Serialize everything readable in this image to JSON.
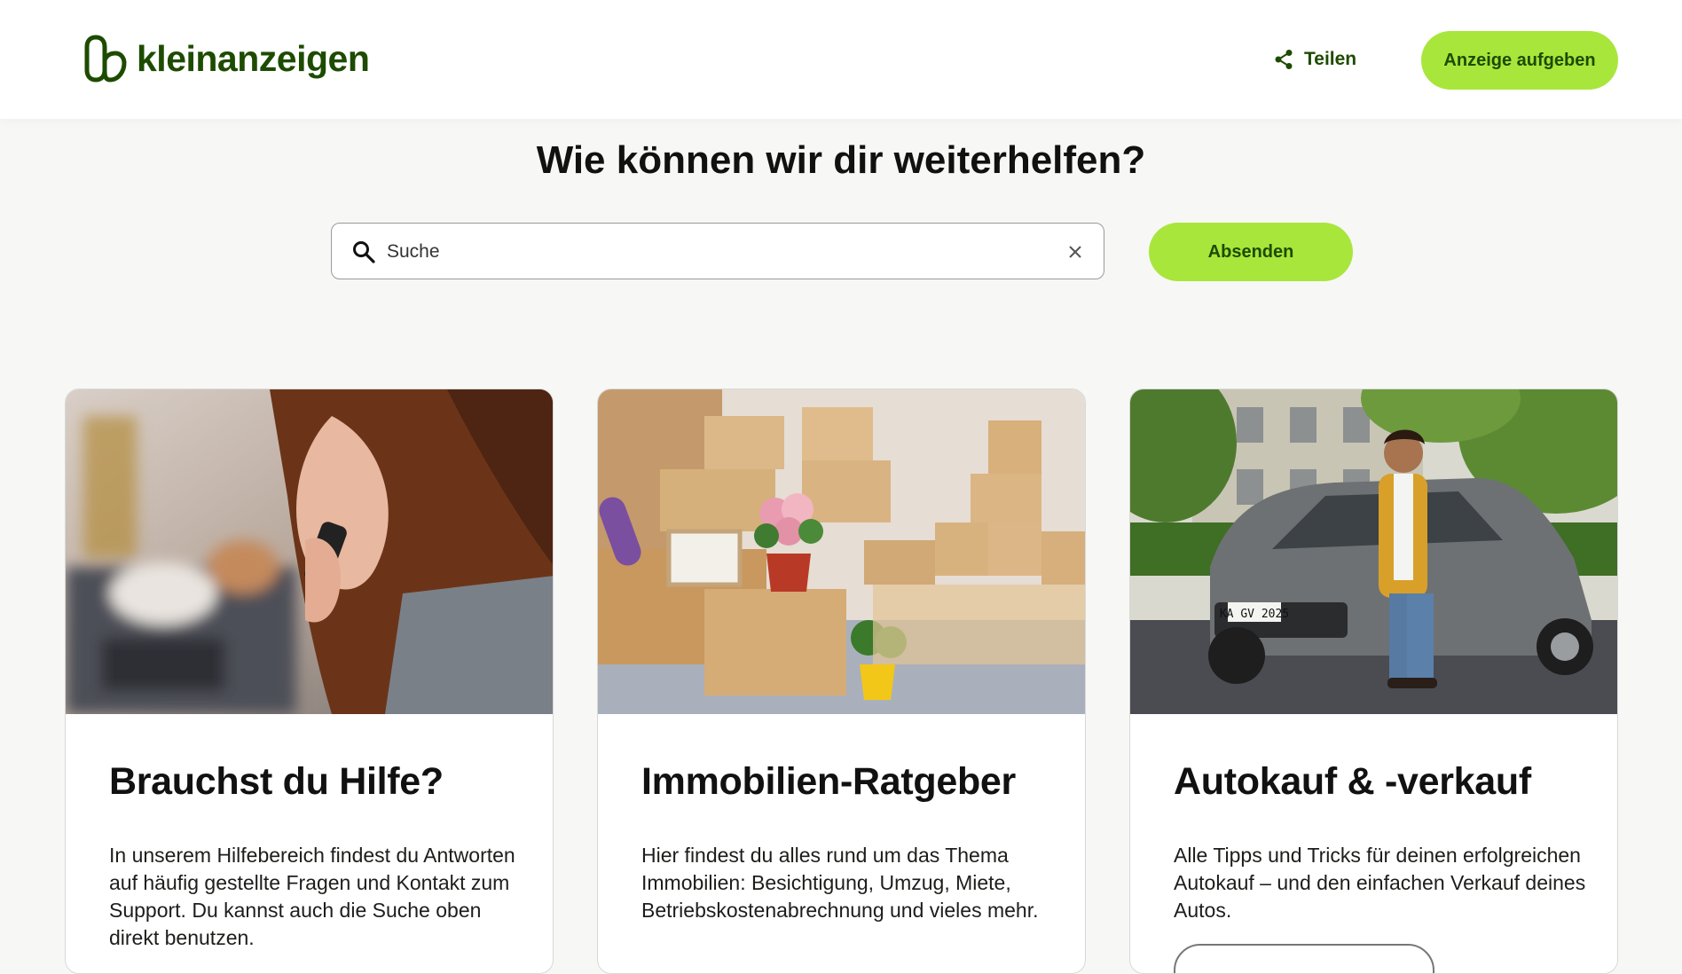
{
  "header": {
    "logo_text": "kleinanzeigen",
    "share_label": "Teilen",
    "post_button": "Anzeige aufgeben"
  },
  "main": {
    "headline": "Wie können wir dir weiterhelfen?",
    "search": {
      "placeholder": "Suche",
      "value": ""
    },
    "submit_button": "Absenden"
  },
  "cards": [
    {
      "title": "Brauchst du Hilfe?",
      "text": "In unserem Hilfebereich findest du Antworten auf häufig gestellte Fragen und Kontakt zum Support. Du kannst auch die Suche oben direkt benutzen."
    },
    {
      "title": "Immobilien-Ratgeber",
      "text": "Hier findest du alles rund um das Thema Immobilien: Besichtigung, Umzug, Miete, Betriebskostenabrechnung und vieles mehr."
    },
    {
      "title": "Autokauf & -verkauf",
      "text": "Alle Tipps und Tricks für deinen erfolgreichen Autokauf – und den einfachen Verkauf deines Autos."
    }
  ],
  "photo_texts": {
    "license_plate": "KA GV 2025"
  },
  "colors": {
    "brand": "#1d4b00",
    "accent": "#a8e63c",
    "background": "#f7f7f5"
  },
  "icons": [
    "kleinanzeigen-logo-icon",
    "share-icon",
    "search-icon",
    "close-icon"
  ]
}
